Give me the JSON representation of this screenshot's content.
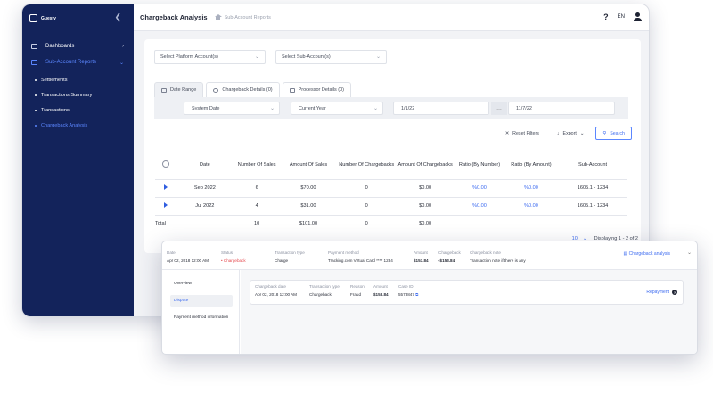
{
  "app": {
    "name": "Guesty"
  },
  "sidebar": {
    "items": [
      {
        "label": "Dashboards"
      },
      {
        "label": "Sub-Account Reports"
      }
    ],
    "subitems": [
      {
        "label": "Settlements"
      },
      {
        "label": "Transactions Summary"
      },
      {
        "label": "Transactions"
      },
      {
        "label": "Chargeback Analysis"
      }
    ]
  },
  "header": {
    "title": "Chargeback Analysis",
    "breadcrumb": "Sub-Account Reports",
    "lang": "EN",
    "help": "?"
  },
  "filters": {
    "platform_placeholder": "Select Platform Account(s)",
    "subaccount_placeholder": "Select Sub-Account(s)",
    "tabs": [
      {
        "label": "Date Range"
      },
      {
        "label": "Chargeback Details (0)"
      },
      {
        "label": "Processor Details (0)"
      }
    ],
    "date_type": "System Date",
    "period": "Current Year",
    "from": "1/1/22",
    "separator": "…",
    "to": "11/7/22"
  },
  "actions": {
    "reset": "Reset Filters",
    "export": "Export",
    "search": "Search"
  },
  "table": {
    "headers": [
      "Date",
      "Number Of Sales",
      "Amount Of Sales",
      "Number Of Chargebacks",
      "Amount Of Chargebacks",
      "Ratio (By Number)",
      "Ratio (By Amount)",
      "Sub-Account"
    ],
    "rows": [
      [
        "Sep 2022",
        "6",
        "$70.00",
        "0",
        "$0.00",
        "%0.00",
        "%0.00",
        "1605.1 - 1234"
      ],
      [
        "Jul 2022",
        "4",
        "$31.00",
        "0",
        "$0.00",
        "%0.00",
        "%0.00",
        "1605.1 - 1234"
      ]
    ],
    "total": [
      "Total",
      "10",
      "$101.00",
      "0",
      "$0.00"
    ]
  },
  "pager": {
    "page_size": "10",
    "caret": "⌄",
    "summary": "Displaying 1 - 2 of 2"
  },
  "detail": {
    "head": [
      {
        "label": "Date",
        "value": "Apr 02, 2018 12:00 AM"
      },
      {
        "label": "Status",
        "value": "• Chargeback"
      },
      {
        "label": "Transaction type",
        "value": "Charge"
      },
      {
        "label": "Payment method",
        "value": "Tracking.com Virtual Card **** 1234"
      },
      {
        "label": "Amount",
        "value": "$153.84"
      },
      {
        "label": "Chargeback",
        "value": "-$153.84"
      },
      {
        "label": "Chargeback note",
        "value": "Transaction note if there is any"
      }
    ],
    "button": "Chargeback analysis",
    "nav": [
      {
        "label": "Overview"
      },
      {
        "label": "Dispute"
      },
      {
        "label": "Payment method information"
      }
    ],
    "row": [
      {
        "label": "Chargeback date",
        "value": "Apr 02, 2018 12:00 AM"
      },
      {
        "label": "Transaction type",
        "value": "Chargeback"
      },
      {
        "label": "Reason",
        "value": "Fraud"
      },
      {
        "label": "Amount",
        "value": "$153.84"
      },
      {
        "label": "Case ID",
        "value": "5573847"
      }
    ],
    "repayment": "Repayment"
  }
}
